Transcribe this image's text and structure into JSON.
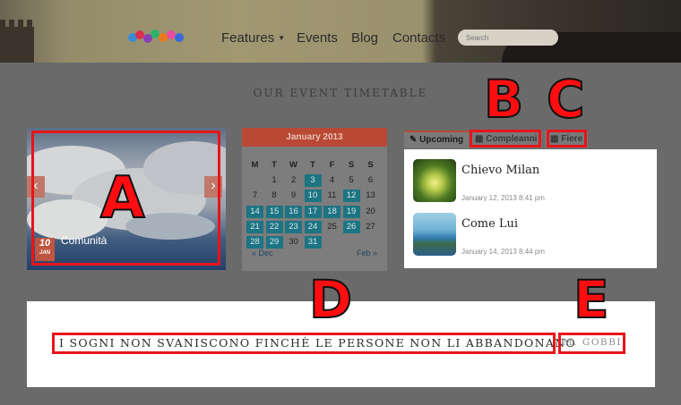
{
  "header": {
    "nav": [
      "Features",
      "Events",
      "Blog",
      "Contacts"
    ],
    "search_placeholder": "Search",
    "logo_icon": "colorful-logo-icon"
  },
  "section": {
    "title": "OUR EVENT TIMETABLE"
  },
  "slider": {
    "caption": "Comunità",
    "date_day": "10",
    "date_month": "JAN",
    "prev_icon": "chevron-left-icon",
    "next_icon": "chevron-right-icon"
  },
  "calendar": {
    "month": "January 2013",
    "weekdays": [
      "M",
      "T",
      "W",
      "T",
      "F",
      "S",
      "S"
    ],
    "weeks": [
      [
        "",
        "1",
        "2",
        "3",
        "4",
        "5",
        "6"
      ],
      [
        "7",
        "8",
        "9",
        "10",
        "11",
        "12",
        "13"
      ],
      [
        "14",
        "15",
        "16",
        "17",
        "18",
        "19",
        "20"
      ],
      [
        "21",
        "22",
        "23",
        "24",
        "25",
        "26",
        "27"
      ],
      [
        "28",
        "29",
        "30",
        "31",
        "",
        "",
        ""
      ]
    ],
    "event_days": [
      "3",
      "10",
      "12",
      "14",
      "15",
      "16",
      "17",
      "18",
      "19",
      "21",
      "22",
      "23",
      "24",
      "26",
      "28",
      "29",
      "31"
    ],
    "prev_label": "« Dec",
    "next_label": "Feb »"
  },
  "events_widget": {
    "tabs": [
      {
        "label": "Upcoming",
        "icon": "pin-icon",
        "active": true
      },
      {
        "label": "Compleanni",
        "icon": "calendar-icon",
        "active": false
      },
      {
        "label": "Fiere",
        "icon": "calendar-icon",
        "active": false
      }
    ],
    "items": [
      {
        "title": "Chievo Milan",
        "date": "January 12, 2013 8:41 pm"
      },
      {
        "title": "Come Lui",
        "date": "January 14, 2013 8:44 pm"
      }
    ]
  },
  "quote": {
    "text": "I SOGNI NON SVANISCONO FINCHÈ LE PERSONE NON LI ABBANDONANO",
    "author": "M. GOBBI"
  },
  "annotations": {
    "letters": [
      "A",
      "B",
      "C",
      "D",
      "E"
    ],
    "color": "#e8141a"
  }
}
